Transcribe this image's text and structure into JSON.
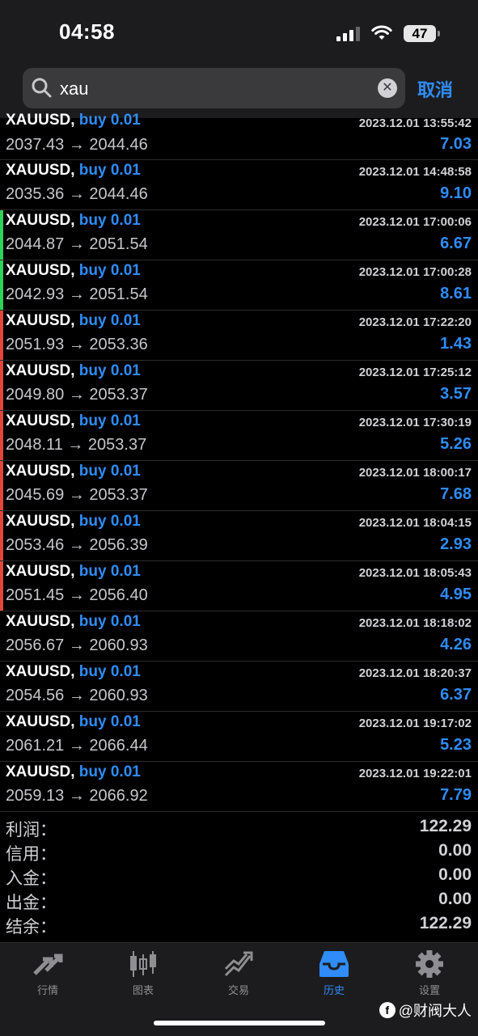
{
  "status": {
    "time": "04:58",
    "battery": "47"
  },
  "search": {
    "value": "xau",
    "cancel_label": "取消"
  },
  "colors": {
    "accent": "#2f8cf8",
    "green": "#30d158",
    "red": "#e0463c"
  },
  "trades": [
    {
      "symbol": "XAUUSD,",
      "side": "buy 0.01",
      "time": "2023.12.01 13:55:42",
      "prices": "2037.43 → 2044.46",
      "profit": "7.03",
      "marker": "none"
    },
    {
      "symbol": "XAUUSD,",
      "side": "buy 0.01",
      "time": "2023.12.01 14:48:58",
      "prices": "2035.36 → 2044.46",
      "profit": "9.10",
      "marker": "none"
    },
    {
      "symbol": "XAUUSD,",
      "side": "buy 0.01",
      "time": "2023.12.01 17:00:06",
      "prices": "2044.87 → 2051.54",
      "profit": "6.67",
      "marker": "green"
    },
    {
      "symbol": "XAUUSD,",
      "side": "buy 0.01",
      "time": "2023.12.01 17:00:28",
      "prices": "2042.93 → 2051.54",
      "profit": "8.61",
      "marker": "green"
    },
    {
      "symbol": "XAUUSD,",
      "side": "buy 0.01",
      "time": "2023.12.01 17:22:20",
      "prices": "2051.93 → 2053.36",
      "profit": "1.43",
      "marker": "red"
    },
    {
      "symbol": "XAUUSD,",
      "side": "buy 0.01",
      "time": "2023.12.01 17:25:12",
      "prices": "2049.80 → 2053.37",
      "profit": "3.57",
      "marker": "red"
    },
    {
      "symbol": "XAUUSD,",
      "side": "buy 0.01",
      "time": "2023.12.01 17:30:19",
      "prices": "2048.11 → 2053.37",
      "profit": "5.26",
      "marker": "red"
    },
    {
      "symbol": "XAUUSD,",
      "side": "buy 0.01",
      "time": "2023.12.01 18:00:17",
      "prices": "2045.69 → 2053.37",
      "profit": "7.68",
      "marker": "red"
    },
    {
      "symbol": "XAUUSD,",
      "side": "buy 0.01",
      "time": "2023.12.01 18:04:15",
      "prices": "2053.46 → 2056.39",
      "profit": "2.93",
      "marker": "red"
    },
    {
      "symbol": "XAUUSD,",
      "side": "buy 0.01",
      "time": "2023.12.01 18:05:43",
      "prices": "2051.45 → 2056.40",
      "profit": "4.95",
      "marker": "red"
    },
    {
      "symbol": "XAUUSD,",
      "side": "buy 0.01",
      "time": "2023.12.01 18:18:02",
      "prices": "2056.67 → 2060.93",
      "profit": "4.26",
      "marker": "none"
    },
    {
      "symbol": "XAUUSD,",
      "side": "buy 0.01",
      "time": "2023.12.01 18:20:37",
      "prices": "2054.56 → 2060.93",
      "profit": "6.37",
      "marker": "none"
    },
    {
      "symbol": "XAUUSD,",
      "side": "buy 0.01",
      "time": "2023.12.01 19:17:02",
      "prices": "2061.21 → 2066.44",
      "profit": "5.23",
      "marker": "none"
    },
    {
      "symbol": "XAUUSD,",
      "side": "buy 0.01",
      "time": "2023.12.01 19:22:01",
      "prices": "2059.13 → 2066.92",
      "profit": "7.79",
      "marker": "none"
    }
  ],
  "summary": [
    {
      "label": "利润：",
      "value": "122.29"
    },
    {
      "label": "信用：",
      "value": "0.00"
    },
    {
      "label": "入金：",
      "value": "0.00"
    },
    {
      "label": "出金：",
      "value": "0.00"
    },
    {
      "label": "结余：",
      "value": "122.29"
    }
  ],
  "tabs": [
    {
      "label": "行情",
      "icon": "quotes-icon",
      "active": false
    },
    {
      "label": "图表",
      "icon": "chart-icon",
      "active": false
    },
    {
      "label": "交易",
      "icon": "trade-icon",
      "active": false
    },
    {
      "label": "历史",
      "icon": "history-icon",
      "active": true
    },
    {
      "label": "设置",
      "icon": "gear-icon",
      "active": false
    }
  ],
  "watermark": {
    "text": "@财阀大人"
  }
}
